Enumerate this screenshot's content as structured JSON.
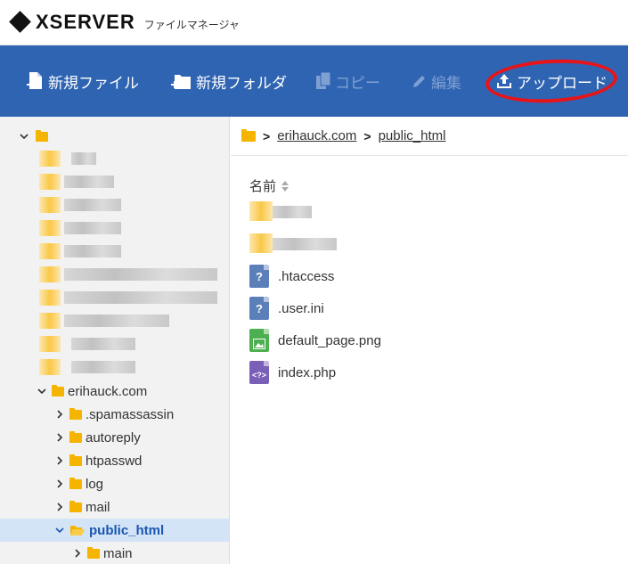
{
  "header": {
    "brand": "XSERVER",
    "subtitle": "ファイルマネージャ"
  },
  "toolbar": {
    "new_file": "新規ファイル",
    "new_folder": "新規フォルダ",
    "copy": "コピー",
    "edit": "編集",
    "upload": "アップロード"
  },
  "sidebar": {
    "domain": "erihauck.com",
    "folders": [
      ".spamassassin",
      "autoreply",
      "htpasswd",
      "log",
      "mail",
      "public_html",
      "main"
    ]
  },
  "breadcrumb": {
    "domain": "erihauck.com",
    "current": "public_html"
  },
  "list": {
    "column_name": "名前",
    "files": [
      {
        "name": ".htaccess",
        "icon": "unknown-file-icon",
        "color": "#5b7fb8",
        "glyph": "?"
      },
      {
        "name": ".user.ini",
        "icon": "unknown-file-icon",
        "color": "#5b7fb8",
        "glyph": "?"
      },
      {
        "name": "default_page.png",
        "icon": "image-file-icon",
        "color": "#4caf50",
        "glyph": ""
      },
      {
        "name": "index.php",
        "icon": "php-file-icon",
        "color": "#7a5fb8",
        "glyph": "<?>"
      }
    ]
  },
  "colors": {
    "toolbar_bg": "#2f64b2",
    "selected_bg": "#d4e4f7",
    "folder": "#f4b400",
    "annotation": "#e8141a"
  }
}
